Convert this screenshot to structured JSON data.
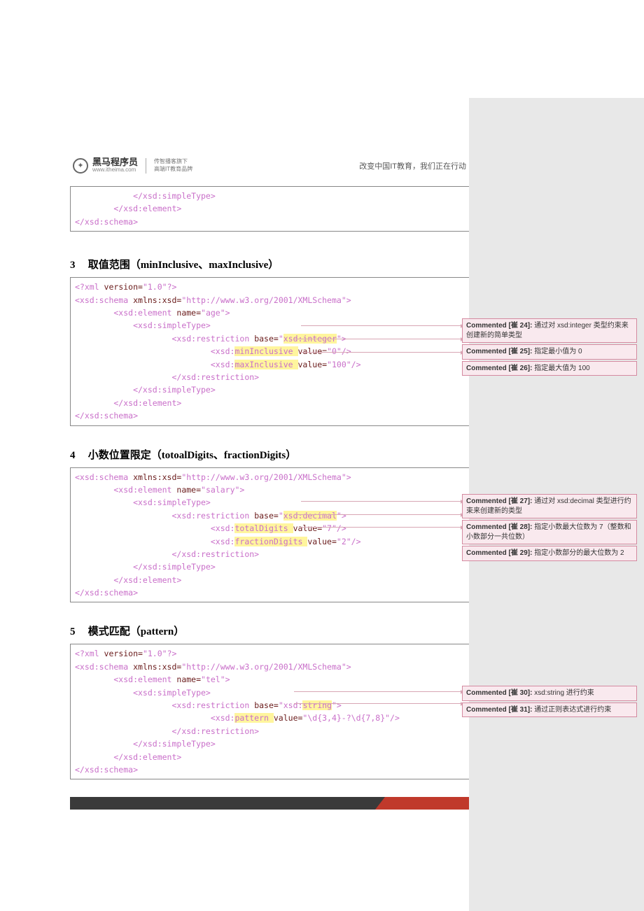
{
  "header": {
    "logo_main": "黑马程序员",
    "logo_sub": "www.itheima.com",
    "logo_slogan1": "传智播客旗下",
    "logo_slogan2": "高端IT教育品牌",
    "tagline": "改变中国IT教育，我们正在行动"
  },
  "code_block_0": {
    "lines": [
      "            </xsd:simpleType>",
      "        </xsd:element>",
      "</xsd:schema>"
    ]
  },
  "section3": {
    "num": "3",
    "title": "取值范围（minInclusive、maxInclusive）"
  },
  "code_block_3": {
    "l1a": "<?xml ",
    "l1b": "version=",
    "l1c": "\"1.0\"",
    "l1d": "?>",
    "l2a": "<xsd:schema ",
    "l2b": "xmlns:xsd=",
    "l2c": "\"http://www.w3.org/2001/XMLSchema\"",
    "l2d": ">",
    "l3a": "        <xsd:element ",
    "l3b": "name=",
    "l3c": "\"age\"",
    "l3d": ">",
    "l4": "            <xsd:simpleType>",
    "l5a": "                    <xsd:restriction ",
    "l5b": "base=",
    "l5c_q": "\"",
    "l5c_hl": "xsd:integer",
    "l5d": ">",
    "l6a": "                            <xsd:",
    "l6hl": "minInclusive ",
    "l6b": "value=",
    "l6c": "\"0\"",
    "l6d": "/>",
    "l7a": "                            <xsd:",
    "l7hl": "maxInclusive ",
    "l7b": "value=",
    "l7c": "\"100\"",
    "l7d": "/>",
    "l8": "                    </xsd:restriction>",
    "l9": "            </xsd:simpleType>",
    "l10": "        </xsd:element>",
    "l11": "</xsd:schema>"
  },
  "section4": {
    "num": "4",
    "title": "小数位置限定（totoalDigits、fractionDigits）"
  },
  "code_block_4": {
    "l1a": "<xsd:schema ",
    "l1b": "xmlns:xsd=",
    "l1c": "\"http://www.w3.org/2001/XMLSchema\"",
    "l1d": ">",
    "l2a": "        <xsd:element ",
    "l2b": "name=",
    "l2c": "\"salary\"",
    "l2d": ">",
    "l3": "            <xsd:simpleType>",
    "l4a": "                    <xsd:restriction ",
    "l4b": "base=",
    "l4c_q": "\"",
    "l4c_hl": "xsd:decimal",
    "l4d": ">",
    "l5a": "                            <xsd:",
    "l5hl": "totalDigits ",
    "l5b": "value=",
    "l5c": "\"7\"",
    "l5d": "/>",
    "l6a": "                            <xsd:",
    "l6hl": "fractionDigits ",
    "l6b": "value=",
    "l6c": "\"2\"",
    "l6d": "/>",
    "l7": "                    </xsd:restriction>",
    "l8": "            </xsd:simpleType>",
    "l9": "        </xsd:element>",
    "l10": "</xsd:schema>"
  },
  "section5": {
    "num": "5",
    "title": "模式匹配（pattern）"
  },
  "code_block_5": {
    "l1a": "<?xml ",
    "l1b": "version=",
    "l1c": "\"1.0\"",
    "l1d": "?>",
    "l2a": "<xsd:schema ",
    "l2b": "xmlns:xsd=",
    "l2c": "\"http://www.w3.org/2001/XMLSchema\"",
    "l2d": ">",
    "l3a": "        <xsd:element ",
    "l3b": "name=",
    "l3c": "\"tel\"",
    "l3d": ">",
    "l4": "            <xsd:simpleType>",
    "l5a": "                    <xsd:restriction ",
    "l5b": "base=",
    "l5c_q": "\"xsd:",
    "l5c_hl": "string",
    "l5d": ">",
    "l6a": "                            <xsd:",
    "l6hl": "pattern ",
    "l6b": "value=",
    "l6c": "\"\\d{3,4}-?\\d{7,8}\"",
    "l6d": "/>",
    "l7": "                    </xsd:restriction>",
    "l8": "            </xsd:simpleType>",
    "l9": "        </xsd:element>",
    "l10": "</xsd:schema>"
  },
  "comments": {
    "c24": {
      "label": "Commented [崔 24]:",
      "text": " 通过对 xsd:integer 类型约束来创建新的简单类型"
    },
    "c25": {
      "label": "Commented [崔 25]:",
      "text": " 指定最小值为 0"
    },
    "c26": {
      "label": "Commented [崔 26]:",
      "text": " 指定最大值为 100"
    },
    "c27": {
      "label": "Commented [崔 27]:",
      "text": " 通过对 xsd:decimal 类型进行约束来创建新的类型"
    },
    "c28": {
      "label": "Commented [崔 28]:",
      "text": " 指定小数最大位数为 7（整数和小数部分一共位数）"
    },
    "c29": {
      "label": "Commented [崔 29]:",
      "text": " 指定小数部分的最大位数为 2"
    },
    "c30": {
      "label": "Commented [崔 30]:",
      "text": " xsd:string 进行约束"
    },
    "c31": {
      "label": "Commented [崔 31]:",
      "text": " 通过正则表达式进行约束"
    }
  }
}
